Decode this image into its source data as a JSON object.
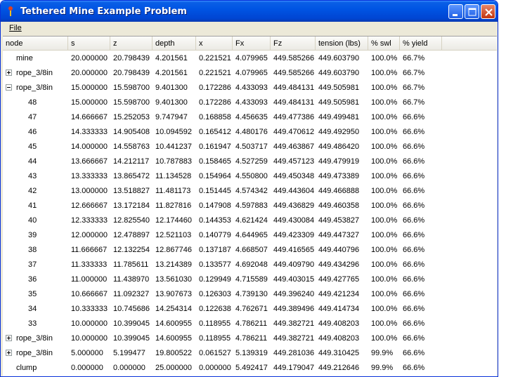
{
  "window": {
    "title": "Tethered Mine Example Problem"
  },
  "menu": {
    "file_label": "File"
  },
  "columns": [
    "node",
    "s",
    "z",
    "depth",
    "x",
    "Fx",
    "Fz",
    "tension (lbs)",
    "% swl",
    "% yield"
  ],
  "rows": [
    {
      "expander": "none",
      "indent": 0,
      "node": "mine",
      "s": "20.000000",
      "z": "20.798439",
      "depth": "4.201561",
      "x": "0.221521",
      "Fx": "4.079965",
      "Fz": "449.585266",
      "tension": "449.603790",
      "swl": "100.0%",
      "yield": "66.7%"
    },
    {
      "expander": "plus",
      "indent": 0,
      "node": "rope_3/8in",
      "s": "20.000000",
      "z": "20.798439",
      "depth": "4.201561",
      "x": "0.221521",
      "Fx": "4.079965",
      "Fz": "449.585266",
      "tension": "449.603790",
      "swl": "100.0%",
      "yield": "66.7%"
    },
    {
      "expander": "minus",
      "indent": 0,
      "node": "rope_3/8in",
      "s": "15.000000",
      "z": "15.598700",
      "depth": "9.401300",
      "x": "0.172286",
      "Fx": "4.433093",
      "Fz": "449.484131",
      "tension": "449.505981",
      "swl": "100.0%",
      "yield": "66.7%"
    },
    {
      "expander": "none",
      "indent": 1,
      "node": "48",
      "s": "15.000000",
      "z": "15.598700",
      "depth": "9.401300",
      "x": "0.172286",
      "Fx": "4.433093",
      "Fz": "449.484131",
      "tension": "449.505981",
      "swl": "100.0%",
      "yield": "66.7%"
    },
    {
      "expander": "none",
      "indent": 1,
      "node": "47",
      "s": "14.666667",
      "z": "15.252053",
      "depth": "9.747947",
      "x": "0.168858",
      "Fx": "4.456635",
      "Fz": "449.477386",
      "tension": "449.499481",
      "swl": "100.0%",
      "yield": "66.6%"
    },
    {
      "expander": "none",
      "indent": 1,
      "node": "46",
      "s": "14.333333",
      "z": "14.905408",
      "depth": "10.094592",
      "x": "0.165412",
      "Fx": "4.480176",
      "Fz": "449.470612",
      "tension": "449.492950",
      "swl": "100.0%",
      "yield": "66.6%"
    },
    {
      "expander": "none",
      "indent": 1,
      "node": "45",
      "s": "14.000000",
      "z": "14.558763",
      "depth": "10.441237",
      "x": "0.161947",
      "Fx": "4.503717",
      "Fz": "449.463867",
      "tension": "449.486420",
      "swl": "100.0%",
      "yield": "66.6%"
    },
    {
      "expander": "none",
      "indent": 1,
      "node": "44",
      "s": "13.666667",
      "z": "14.212117",
      "depth": "10.787883",
      "x": "0.158465",
      "Fx": "4.527259",
      "Fz": "449.457123",
      "tension": "449.479919",
      "swl": "100.0%",
      "yield": "66.6%"
    },
    {
      "expander": "none",
      "indent": 1,
      "node": "43",
      "s": "13.333333",
      "z": "13.865472",
      "depth": "11.134528",
      "x": "0.154964",
      "Fx": "4.550800",
      "Fz": "449.450348",
      "tension": "449.473389",
      "swl": "100.0%",
      "yield": "66.6%"
    },
    {
      "expander": "none",
      "indent": 1,
      "node": "42",
      "s": "13.000000",
      "z": "13.518827",
      "depth": "11.481173",
      "x": "0.151445",
      "Fx": "4.574342",
      "Fz": "449.443604",
      "tension": "449.466888",
      "swl": "100.0%",
      "yield": "66.6%"
    },
    {
      "expander": "none",
      "indent": 1,
      "node": "41",
      "s": "12.666667",
      "z": "13.172184",
      "depth": "11.827816",
      "x": "0.147908",
      "Fx": "4.597883",
      "Fz": "449.436829",
      "tension": "449.460358",
      "swl": "100.0%",
      "yield": "66.6%"
    },
    {
      "expander": "none",
      "indent": 1,
      "node": "40",
      "s": "12.333333",
      "z": "12.825540",
      "depth": "12.174460",
      "x": "0.144353",
      "Fx": "4.621424",
      "Fz": "449.430084",
      "tension": "449.453827",
      "swl": "100.0%",
      "yield": "66.6%"
    },
    {
      "expander": "none",
      "indent": 1,
      "node": "39",
      "s": "12.000000",
      "z": "12.478897",
      "depth": "12.521103",
      "x": "0.140779",
      "Fx": "4.644965",
      "Fz": "449.423309",
      "tension": "449.447327",
      "swl": "100.0%",
      "yield": "66.6%"
    },
    {
      "expander": "none",
      "indent": 1,
      "node": "38",
      "s": "11.666667",
      "z": "12.132254",
      "depth": "12.867746",
      "x": "0.137187",
      "Fx": "4.668507",
      "Fz": "449.416565",
      "tension": "449.440796",
      "swl": "100.0%",
      "yield": "66.6%"
    },
    {
      "expander": "none",
      "indent": 1,
      "node": "37",
      "s": "11.333333",
      "z": "11.785611",
      "depth": "13.214389",
      "x": "0.133577",
      "Fx": "4.692048",
      "Fz": "449.409790",
      "tension": "449.434296",
      "swl": "100.0%",
      "yield": "66.6%"
    },
    {
      "expander": "none",
      "indent": 1,
      "node": "36",
      "s": "11.000000",
      "z": "11.438970",
      "depth": "13.561030",
      "x": "0.129949",
      "Fx": "4.715589",
      "Fz": "449.403015",
      "tension": "449.427765",
      "swl": "100.0%",
      "yield": "66.6%"
    },
    {
      "expander": "none",
      "indent": 1,
      "node": "35",
      "s": "10.666667",
      "z": "11.092327",
      "depth": "13.907673",
      "x": "0.126303",
      "Fx": "4.739130",
      "Fz": "449.396240",
      "tension": "449.421234",
      "swl": "100.0%",
      "yield": "66.6%"
    },
    {
      "expander": "none",
      "indent": 1,
      "node": "34",
      "s": "10.333333",
      "z": "10.745686",
      "depth": "14.254314",
      "x": "0.122638",
      "Fx": "4.762671",
      "Fz": "449.389496",
      "tension": "449.414734",
      "swl": "100.0%",
      "yield": "66.6%"
    },
    {
      "expander": "none",
      "indent": 1,
      "node": "33",
      "s": "10.000000",
      "z": "10.399045",
      "depth": "14.600955",
      "x": "0.118955",
      "Fx": "4.786211",
      "Fz": "449.382721",
      "tension": "449.408203",
      "swl": "100.0%",
      "yield": "66.6%"
    },
    {
      "expander": "plus",
      "indent": 0,
      "node": "rope_3/8in",
      "s": "10.000000",
      "z": "10.399045",
      "depth": "14.600955",
      "x": "0.118955",
      "Fx": "4.786211",
      "Fz": "449.382721",
      "tension": "449.408203",
      "swl": "100.0%",
      "yield": "66.6%"
    },
    {
      "expander": "plus",
      "indent": 0,
      "node": "rope_3/8in",
      "s": "5.000000",
      "z": "5.199477",
      "depth": "19.800522",
      "x": "0.061527",
      "Fx": "5.139319",
      "Fz": "449.281036",
      "tension": "449.310425",
      "swl": "99.9%",
      "yield": "66.6%"
    },
    {
      "expander": "none",
      "indent": 0,
      "node": "clump",
      "s": "0.000000",
      "z": "0.000000",
      "depth": "25.000000",
      "x": "0.000000",
      "Fx": "5.492417",
      "Fz": "449.179047",
      "tension": "449.212646",
      "swl": "99.9%",
      "yield": "66.6%"
    }
  ]
}
